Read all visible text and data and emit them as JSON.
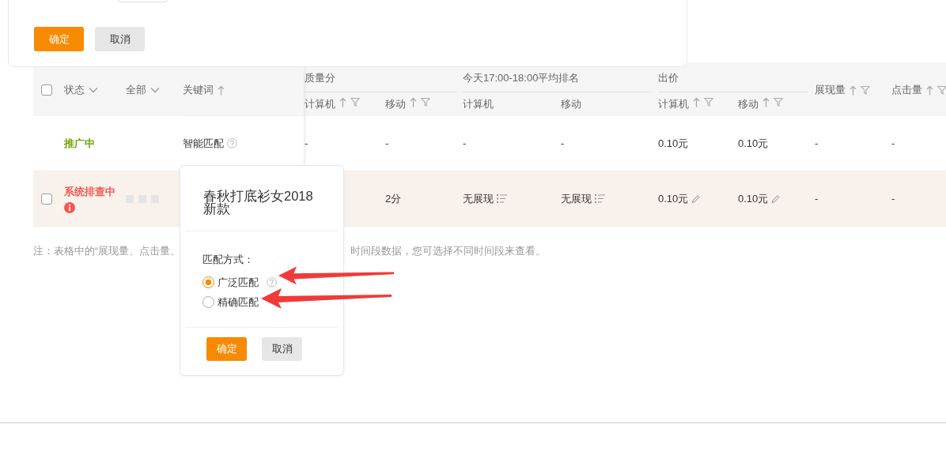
{
  "top_panel": {
    "buttons": [
      {
        "label": "确定",
        "kind": "primary"
      },
      {
        "label": "取消",
        "kind": "secondary"
      }
    ]
  },
  "table": {
    "header_checkbox": {
      "checked": false
    },
    "columns": [
      {
        "label": "状态",
        "kind": "dropdown"
      },
      {
        "label": "全部",
        "kind": "dropdown"
      },
      {
        "label": "关键词",
        "kind": "sort"
      },
      {
        "label": "计算机",
        "kind": "sort_filter",
        "group": "质量分"
      },
      {
        "label": "移动",
        "kind": "sort_filter"
      },
      {
        "label": "计算机",
        "kind": "plain",
        "group": "今天17:00-18:00平均排名"
      },
      {
        "label": "移动",
        "kind": "plain"
      },
      {
        "label": "计算机",
        "kind": "sort_filter",
        "group": "出价"
      },
      {
        "label": "移动",
        "kind": "sort_filter"
      },
      {
        "label": "展现量",
        "kind": "sort_filter"
      },
      {
        "label": "点击量",
        "kind": "sort_filter"
      }
    ],
    "rows": [
      {
        "highlighted": false,
        "cells": [
          {
            "text": "推广中",
            "kind": "status_active"
          },
          "",
          {
            "text": "智能匹配",
            "kind": "with_help"
          },
          {
            "text": "-",
            "kind": "text"
          },
          {
            "text": "-",
            "kind": "text"
          },
          {
            "text": "-",
            "kind": "text"
          },
          {
            "text": "-",
            "kind": "text"
          },
          {
            "text": "0.10元",
            "kind": "text"
          },
          {
            "text": "0.10元",
            "kind": "text"
          },
          {
            "text": "-",
            "kind": "text"
          },
          {
            "text": "-",
            "kind": "text"
          }
        ]
      },
      {
        "highlighted": true,
        "checked": false,
        "cells": [
          {
            "text": "系统排查中",
            "kind": "status_error"
          },
          {
            "kind": "masked"
          },
          "",
          "",
          {
            "text": "2分",
            "kind": "text"
          },
          {
            "text": "无展现",
            "kind": "with_list"
          },
          {
            "text": "无展现",
            "kind": "with_list"
          },
          {
            "text": "0.10元",
            "kind": "editable"
          },
          {
            "text": "0.10元",
            "kind": "editable"
          },
          {
            "text": "-",
            "kind": "text"
          },
          {
            "text": "-",
            "kind": "text"
          }
        ]
      }
    ]
  },
  "note": {
    "parts": [
      "注：表格中的“展现量、点击量、",
      "时间段数据，您可选择不同时间段来查看。"
    ]
  },
  "popover": {
    "title": "春秋打底衫女2018新款",
    "label": "匹配方式：",
    "options": [
      {
        "label": "广泛匹配",
        "selected": true,
        "help": true
      },
      {
        "label": "精确匹配",
        "selected": false,
        "help": false
      }
    ],
    "buttons": [
      {
        "label": "确定",
        "kind": "primary"
      },
      {
        "label": "取消",
        "kind": "secondary"
      }
    ]
  },
  "annotations": [
    {
      "kind": "arrow"
    },
    {
      "kind": "arrow"
    }
  ]
}
